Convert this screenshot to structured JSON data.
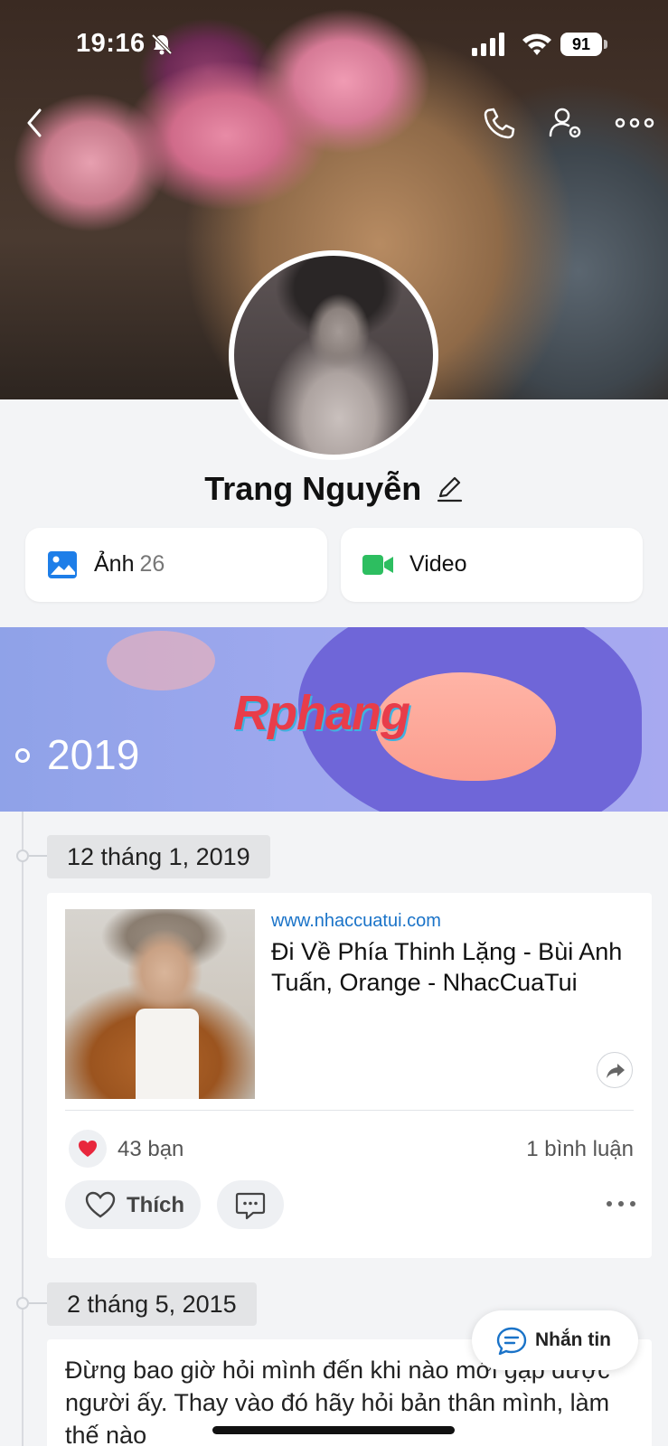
{
  "status_bar": {
    "time": "19:16",
    "battery_level": "91"
  },
  "profile": {
    "name": "Trang Nguyễn"
  },
  "quick_links": {
    "photos_label": "Ảnh",
    "photos_count": "26",
    "videos_label": "Video"
  },
  "timeline": {
    "year": "2019",
    "banner_watermark": "Rphang",
    "posts": [
      {
        "date": "12 tháng 1, 2019",
        "link_domain": "www.nhaccuatui.com",
        "link_title": "Đi Về Phía Thinh Lặng - Bùi Anh Tuấn, Orange - NhacCuaTui",
        "likes": "43 bạn",
        "comments": "1 bình luận",
        "like_label": "Thích"
      },
      {
        "date": "2 tháng 5, 2015",
        "text": "Đừng bao giờ hỏi mình đến khi nào mới gặp được người ấy. Thay vào đó hãy hỏi bản thân mình, làm thế nào"
      }
    ]
  },
  "message_button": {
    "label": "Nhắn tin"
  },
  "colors": {
    "accent": "#1a73c8",
    "heart": "#e8273c",
    "video_green": "#2dbe60"
  },
  "icons": [
    "bell-muted-icon",
    "signal-icon",
    "wifi-icon",
    "back-icon",
    "phone-icon",
    "profile-settings-icon",
    "more-icon",
    "edit-icon",
    "photo-icon",
    "video-icon",
    "share-icon",
    "heart-icon",
    "comment-icon",
    "chat-icon"
  ]
}
